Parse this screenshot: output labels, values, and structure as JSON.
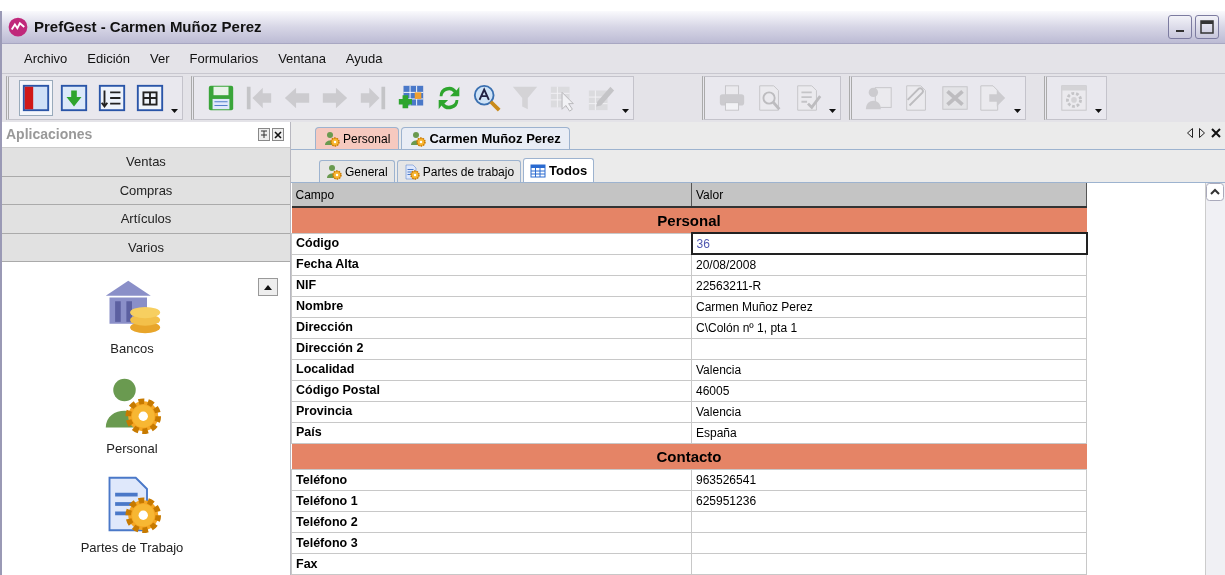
{
  "window": {
    "title": "PrefGest - Carmen Muñoz Perez"
  },
  "menu": [
    {
      "label": "Archivo"
    },
    {
      "label": "Edición"
    },
    {
      "label": "Ver"
    },
    {
      "label": "Formularios"
    },
    {
      "label": "Ventana"
    },
    {
      "label": "Ayuda"
    }
  ],
  "toolbar": [
    {
      "buttons": [
        {
          "kind": "panel",
          "disabled": false,
          "selected": true
        },
        {
          "kind": "download",
          "disabled": false,
          "selected": false
        },
        {
          "kind": "list",
          "disabled": false,
          "selected": false
        },
        {
          "kind": "grid",
          "disabled": false,
          "selected": false
        }
      ]
    },
    {
      "buttons": [
        {
          "kind": "save",
          "disabled": false
        },
        {
          "kind": "first",
          "disabled": true
        },
        {
          "kind": "prev",
          "disabled": true
        },
        {
          "kind": "next",
          "disabled": true
        },
        {
          "kind": "last",
          "disabled": true
        },
        {
          "kind": "addgrid",
          "disabled": false
        },
        {
          "kind": "refresh",
          "disabled": false
        },
        {
          "kind": "spell",
          "disabled": false
        },
        {
          "kind": "filter",
          "disabled": true
        },
        {
          "kind": "select",
          "disabled": true
        },
        {
          "kind": "edit",
          "disabled": true
        }
      ]
    },
    {
      "buttons": [
        {
          "kind": "print",
          "disabled": true
        },
        {
          "kind": "preview",
          "disabled": true
        },
        {
          "kind": "report",
          "disabled": true
        }
      ]
    },
    {
      "buttons": [
        {
          "kind": "contact",
          "disabled": true
        },
        {
          "kind": "attach",
          "disabled": true
        },
        {
          "kind": "excel",
          "disabled": true
        },
        {
          "kind": "export",
          "disabled": true
        }
      ]
    },
    {
      "buttons": [
        {
          "kind": "settings",
          "disabled": true
        }
      ]
    }
  ],
  "sidebar": {
    "title": "Aplicaciones",
    "sections": [
      {
        "label": "Ventas"
      },
      {
        "label": "Compras"
      },
      {
        "label": "Artículos"
      },
      {
        "label": "Varios"
      }
    ],
    "items": [
      {
        "label": "Bancos",
        "kind": "bank"
      },
      {
        "label": "Personal",
        "kind": "person"
      },
      {
        "label": "Partes de Trabajo",
        "kind": "document"
      }
    ]
  },
  "doc_tabs": [
    {
      "label": "Personal",
      "selected": false
    },
    {
      "label": "Carmen Muñoz Perez",
      "selected": true
    }
  ],
  "sub_tabs": [
    {
      "label": "General",
      "kind": "person",
      "selected": false
    },
    {
      "label": "Partes de trabajo",
      "kind": "document",
      "selected": false
    },
    {
      "label": "Todos",
      "kind": "table",
      "selected": true
    }
  ],
  "table": {
    "columns": [
      "Campo",
      "Valor"
    ],
    "rows": [
      {
        "kind": "section",
        "label": "Personal"
      },
      {
        "kind": "field",
        "label": "Código",
        "value": "36",
        "selected": true
      },
      {
        "kind": "field",
        "label": "Fecha Alta",
        "value": "20/08/2008",
        "selected": false
      },
      {
        "kind": "field",
        "label": "NIF",
        "value": "22563211-R",
        "selected": false
      },
      {
        "kind": "field",
        "label": "Nombre",
        "value": "Carmen Muñoz Perez",
        "selected": false
      },
      {
        "kind": "field",
        "label": "Dirección",
        "value": "C\\Colón nº 1, pta 1",
        "selected": false
      },
      {
        "kind": "field",
        "label": "Dirección 2",
        "selected": false
      },
      {
        "kind": "field",
        "label": "Localidad",
        "value": "Valencia",
        "selected": false
      },
      {
        "kind": "field",
        "label": "Código Postal",
        "value": "46005",
        "selected": false
      },
      {
        "kind": "field",
        "label": "Provincia",
        "value": "Valencia",
        "selected": false
      },
      {
        "kind": "field",
        "label": "País",
        "value": "España",
        "selected": false
      },
      {
        "kind": "section",
        "label": "Contacto"
      },
      {
        "kind": "field",
        "label": "Teléfono",
        "value": "963526541",
        "selected": false
      },
      {
        "kind": "field",
        "label": "Teléfono 1",
        "value": "625951236",
        "selected": false
      },
      {
        "kind": "field",
        "label": "Teléfono 2",
        "selected": false
      },
      {
        "kind": "field",
        "label": "Teléfono 3",
        "selected": false
      },
      {
        "kind": "field",
        "label": "Fax",
        "selected": false
      }
    ]
  }
}
